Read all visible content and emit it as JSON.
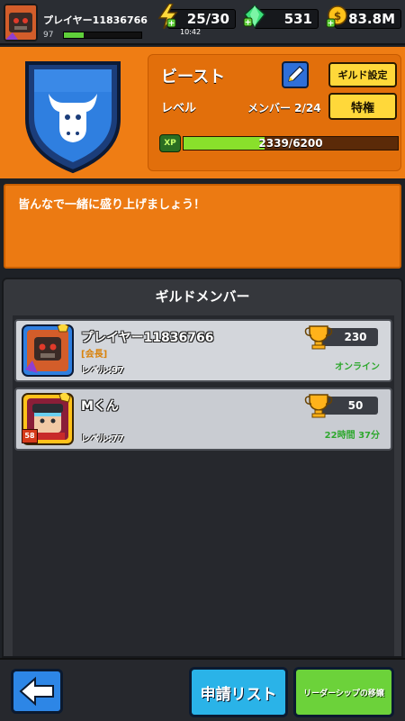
{
  "player": {
    "name": "プレイヤー11836766",
    "level": "97",
    "xp_fraction": 0.25
  },
  "resources": {
    "energy": "25/30",
    "energy_timer": "10:42",
    "gems": "531",
    "coins": "83.8M"
  },
  "guild": {
    "name": "ビースト",
    "settings_label": "ギルド設定",
    "level_label": "レベル",
    "members_count": "メンバー 2/24",
    "perk_label": "特権",
    "xp_icon_label": "XP",
    "xp_text": "2339/6200",
    "xp_current": 2339,
    "xp_max": 6200,
    "description": "皆んなで一緒に盛り上げましょう！",
    "emblem_color": "#2f7fe0"
  },
  "members_panel": {
    "title": "ギルドメンバー",
    "members": [
      {
        "name": "プレイヤー11836766",
        "role": "[会長]",
        "level": "レベル:97",
        "trophies": "230",
        "status": "オンライン",
        "status_color": "#2fa82f"
      },
      {
        "name": "Mくん",
        "role": "",
        "level": "レベル:77",
        "trophies": "50",
        "status": "22時間 37分",
        "status_color": "#2fa82f",
        "badge_level": "58"
      }
    ]
  },
  "bottom": {
    "back_icon": "arrow-left-icon",
    "apply_list_label": "申請リスト",
    "transfer_label": "リーダーシップの移譲"
  }
}
